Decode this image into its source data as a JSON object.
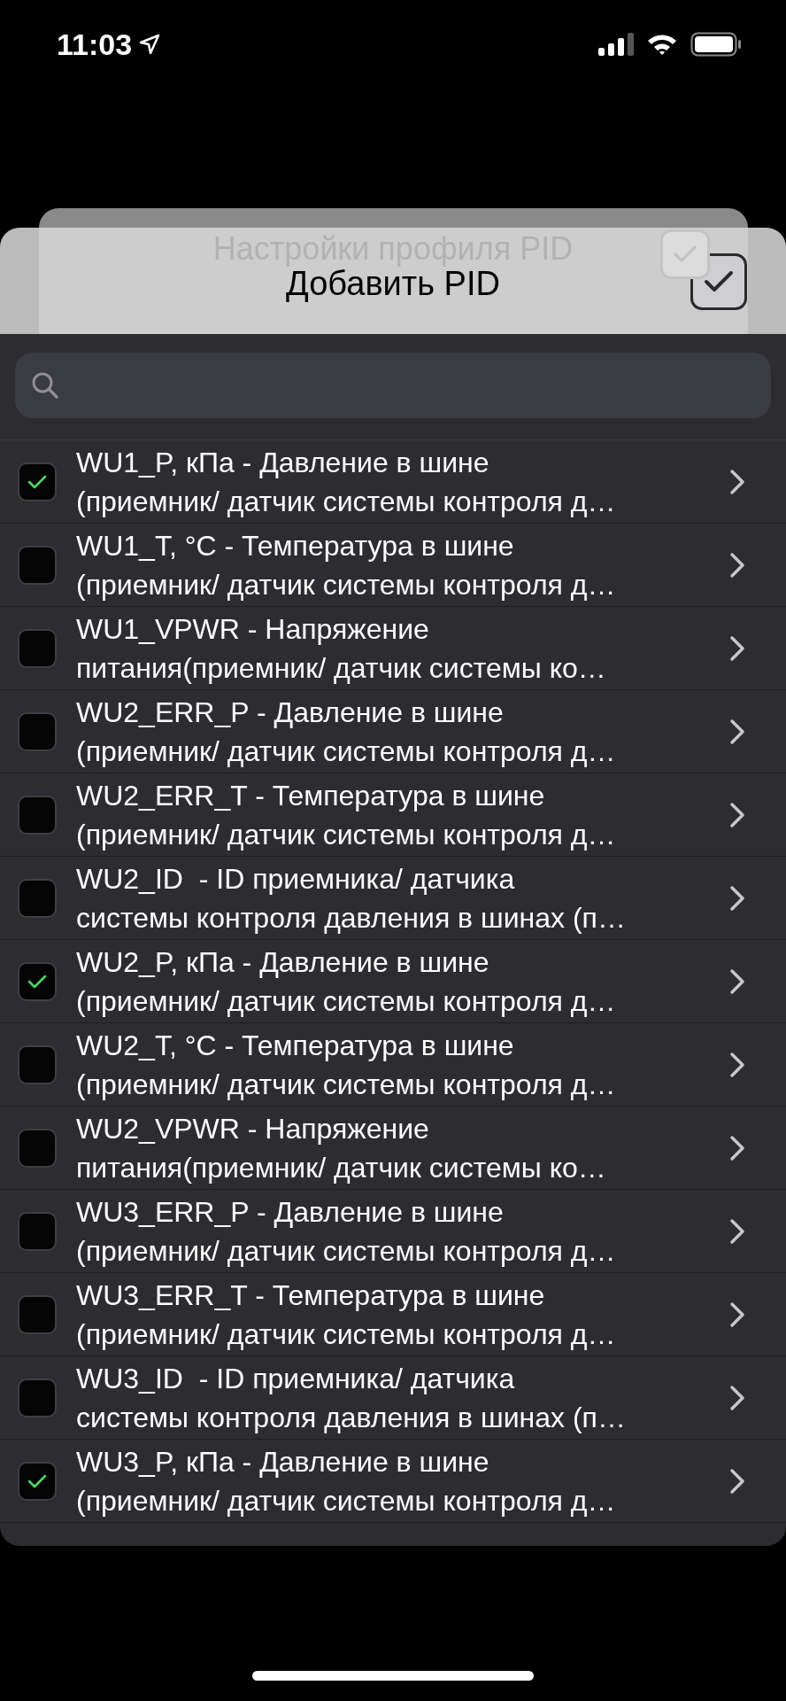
{
  "status_bar": {
    "time": "11:03"
  },
  "back_sheet": {
    "title": "Настройки профиля PID",
    "confirm_checked": true
  },
  "sheet": {
    "title": "Добавить PID",
    "confirm_checked": true
  },
  "rows": [
    {
      "lines": [
        "WU1_P, кПа - Давление в шине",
        "(приемник/ датчик системы контроля д…"
      ],
      "checked": true
    },
    {
      "lines": [
        "WU1_T, °C - Температура в шине",
        "(приемник/ датчик системы контроля д…"
      ],
      "checked": false
    },
    {
      "lines": [
        "WU1_VPWR - Напряжение",
        "питания(приемник/ датчик системы ко…"
      ],
      "checked": false
    },
    {
      "lines": [
        "WU2_ERR_P - Давление в шине",
        "(приемник/ датчик системы контроля д…"
      ],
      "checked": false
    },
    {
      "lines": [
        "WU2_ERR_T - Температура в шине",
        "(приемник/ датчик системы контроля д…"
      ],
      "checked": false
    },
    {
      "lines": [
        "WU2_ID  - ID приемника/ датчика",
        "системы контроля давления в шинах (п…"
      ],
      "checked": false
    },
    {
      "lines": [
        "WU2_P, кПа - Давление в шине",
        "(приемник/ датчик системы контроля д…"
      ],
      "checked": true
    },
    {
      "lines": [
        "WU2_T, °C - Температура в шине",
        "(приемник/ датчик системы контроля д…"
      ],
      "checked": false
    },
    {
      "lines": [
        "WU2_VPWR - Напряжение",
        "питания(приемник/ датчик системы ко…"
      ],
      "checked": false
    },
    {
      "lines": [
        "WU3_ERR_P - Давление в шине",
        "(приемник/ датчик системы контроля д…"
      ],
      "checked": false
    },
    {
      "lines": [
        "WU3_ERR_T - Температура в шине",
        "(приемник/ датчик системы контроля д…"
      ],
      "checked": false
    },
    {
      "lines": [
        "WU3_ID  - ID приемника/ датчика",
        "системы контроля давления в шинах (п…"
      ],
      "checked": false
    },
    {
      "lines": [
        "WU3_P, кПа - Давление в шине",
        "(приемник/ датчик системы контроля д…"
      ],
      "checked": true
    }
  ]
}
